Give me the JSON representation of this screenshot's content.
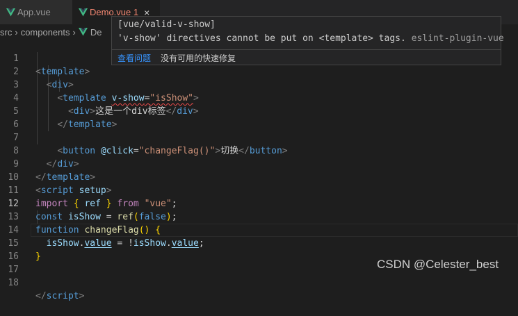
{
  "tabs": [
    {
      "label": "App.vue",
      "icon": "vue-logo-icon",
      "active": false
    },
    {
      "label": "Demo.vue 1",
      "icon": "vue-logo-icon",
      "active": true,
      "close": "×"
    }
  ],
  "breadcrumb": [
    "src",
    "components",
    "De"
  ],
  "editor": {
    "current_line": 12,
    "lines": [
      {
        "n": "1"
      },
      {
        "n": "2"
      },
      {
        "n": "3"
      },
      {
        "n": "4"
      },
      {
        "n": "5"
      },
      {
        "n": "6"
      },
      {
        "n": "7"
      },
      {
        "n": "8"
      },
      {
        "n": "9"
      },
      {
        "n": "10"
      },
      {
        "n": "11"
      },
      {
        "n": "12"
      },
      {
        "n": "13"
      },
      {
        "n": "14"
      },
      {
        "n": "15"
      },
      {
        "n": "16"
      },
      {
        "n": "17"
      },
      {
        "n": "18"
      }
    ],
    "tokens": {
      "template": "template",
      "div": "div",
      "v_show_attr": "v-show",
      "is_show_str": "\"isShow\"",
      "div_text": "这是一个div标签",
      "button": "button",
      "click_attr": "@click",
      "change_flag_str": "\"changeFlag()\"",
      "button_text": "切换",
      "script": "script",
      "setup": "setup",
      "import": "import",
      "ref": "ref",
      "from": "from",
      "vue_str": "\"vue\"",
      "const": "const",
      "is_show": "isShow",
      "false": "false",
      "function": "function",
      "change_flag": "changeFlag",
      "value": "value"
    }
  },
  "hover": {
    "rule": "[vue/valid-v-show]",
    "message": "'v-show' directives cannot be put on <template> tags.",
    "source": "eslint-plugin-vue",
    "view_problem": "查看问题",
    "no_fix": "没有可用的快速修复"
  },
  "watermark": "CSDN @Celester_best",
  "colors": {
    "error": "#f14c4c",
    "link": "#3794ff",
    "tab_error": "#f48771",
    "vue_green": "#41b883"
  }
}
